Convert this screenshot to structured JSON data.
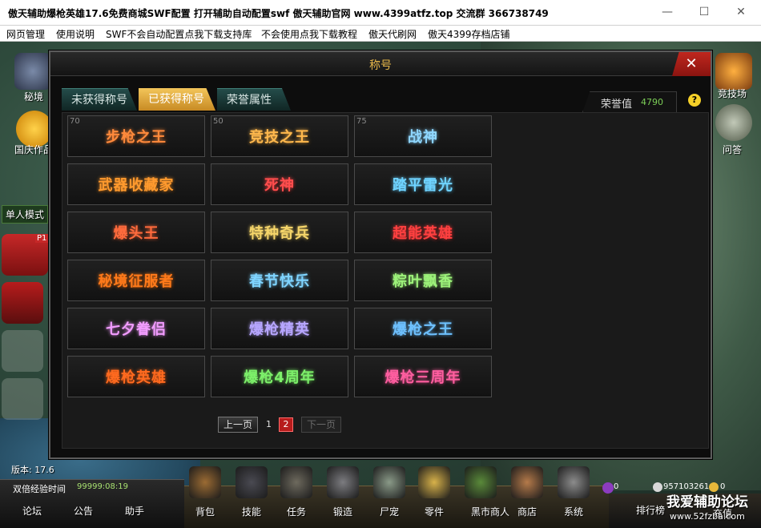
{
  "window": {
    "title": "傲天辅助爆枪英雄17.6免费商城SWF配置  打开辅助自动配置swf 傲天辅助官网 www.4399atfz.top 交流群 366738749",
    "minimize": "—",
    "maximize": "☐",
    "close": "✕"
  },
  "menu": [
    "网页管理",
    "使用说明",
    "SWF不会自动配置点我下载支持库",
    "不会使用点我下载教程",
    "傲天代刷网",
    "傲天4399存档店铺"
  ],
  "side_left": {
    "mijing": "秘境",
    "guoqing": "国庆作品",
    "danren": "单人模式",
    "p1": "P1",
    "version": "版本: 17.6"
  },
  "side_right": {
    "jingji": "竞技场",
    "wenda": "问答"
  },
  "dialog": {
    "title": "称号",
    "close": "✕",
    "help": "?",
    "tabs": [
      "未获得称号",
      "已获得称号",
      "荣誉属性"
    ],
    "honor_label": "荣誉值",
    "honor_value": "4790",
    "titles": [
      {
        "name": "步枪之王",
        "level": "70",
        "color": "#ff8a3c"
      },
      {
        "name": "竞技之王",
        "level": "50",
        "color": "#ffb84d"
      },
      {
        "name": "战神",
        "level": "75",
        "color": "#8fd7ff"
      },
      {
        "name": "武器收藏家",
        "level": "",
        "color": "#ff9a2e"
      },
      {
        "name": "死神",
        "level": "",
        "color": "#ff4d4d"
      },
      {
        "name": "踏平雷光",
        "level": "",
        "color": "#6fd3ff"
      },
      {
        "name": "爆头王",
        "level": "",
        "color": "#ff6b3d"
      },
      {
        "name": "特种奇兵",
        "level": "",
        "color": "#f5d56a"
      },
      {
        "name": "超能英雄",
        "level": "",
        "color": "#ff4040"
      },
      {
        "name": "秘境征服者",
        "level": "",
        "color": "#ff7a1a"
      },
      {
        "name": "春节快乐",
        "level": "",
        "color": "#7fd4ff"
      },
      {
        "name": "粽叶飘香",
        "level": "",
        "color": "#9df27a"
      },
      {
        "name": "七夕眷侣",
        "level": "",
        "color": "#f29cff"
      },
      {
        "name": "爆枪精英",
        "level": "",
        "color": "#b7a6ff"
      },
      {
        "name": "爆枪之王",
        "level": "",
        "color": "#6ec1ff"
      },
      {
        "name": "爆枪英雄",
        "level": "",
        "color": "#ff6a1f"
      },
      {
        "name": "爆枪4周年",
        "level": "",
        "color": "#7df06a"
      },
      {
        "name": "爆枪三周年",
        "level": "",
        "color": "#ff5ea0"
      }
    ],
    "pagination": {
      "prev": "上一页",
      "page1": "1",
      "page2": "2",
      "next": "下一页"
    }
  },
  "bottom": {
    "double_exp": "双倍经验时间",
    "double_exp_value": "99999:08:19",
    "left_links": [
      "论坛",
      "公告",
      "助手"
    ],
    "actions": [
      "背包",
      "技能",
      "任务",
      "锻造",
      "尸宠",
      "零件",
      "黑市商人",
      "商店",
      "系统"
    ],
    "ranking": "排行榜",
    "recharge": "充值",
    "coin1": "0",
    "coin2": "957103261",
    "coin3": "0",
    "watermark": "我爱辅助论坛",
    "watermark_url": "www.52fzba.com"
  }
}
